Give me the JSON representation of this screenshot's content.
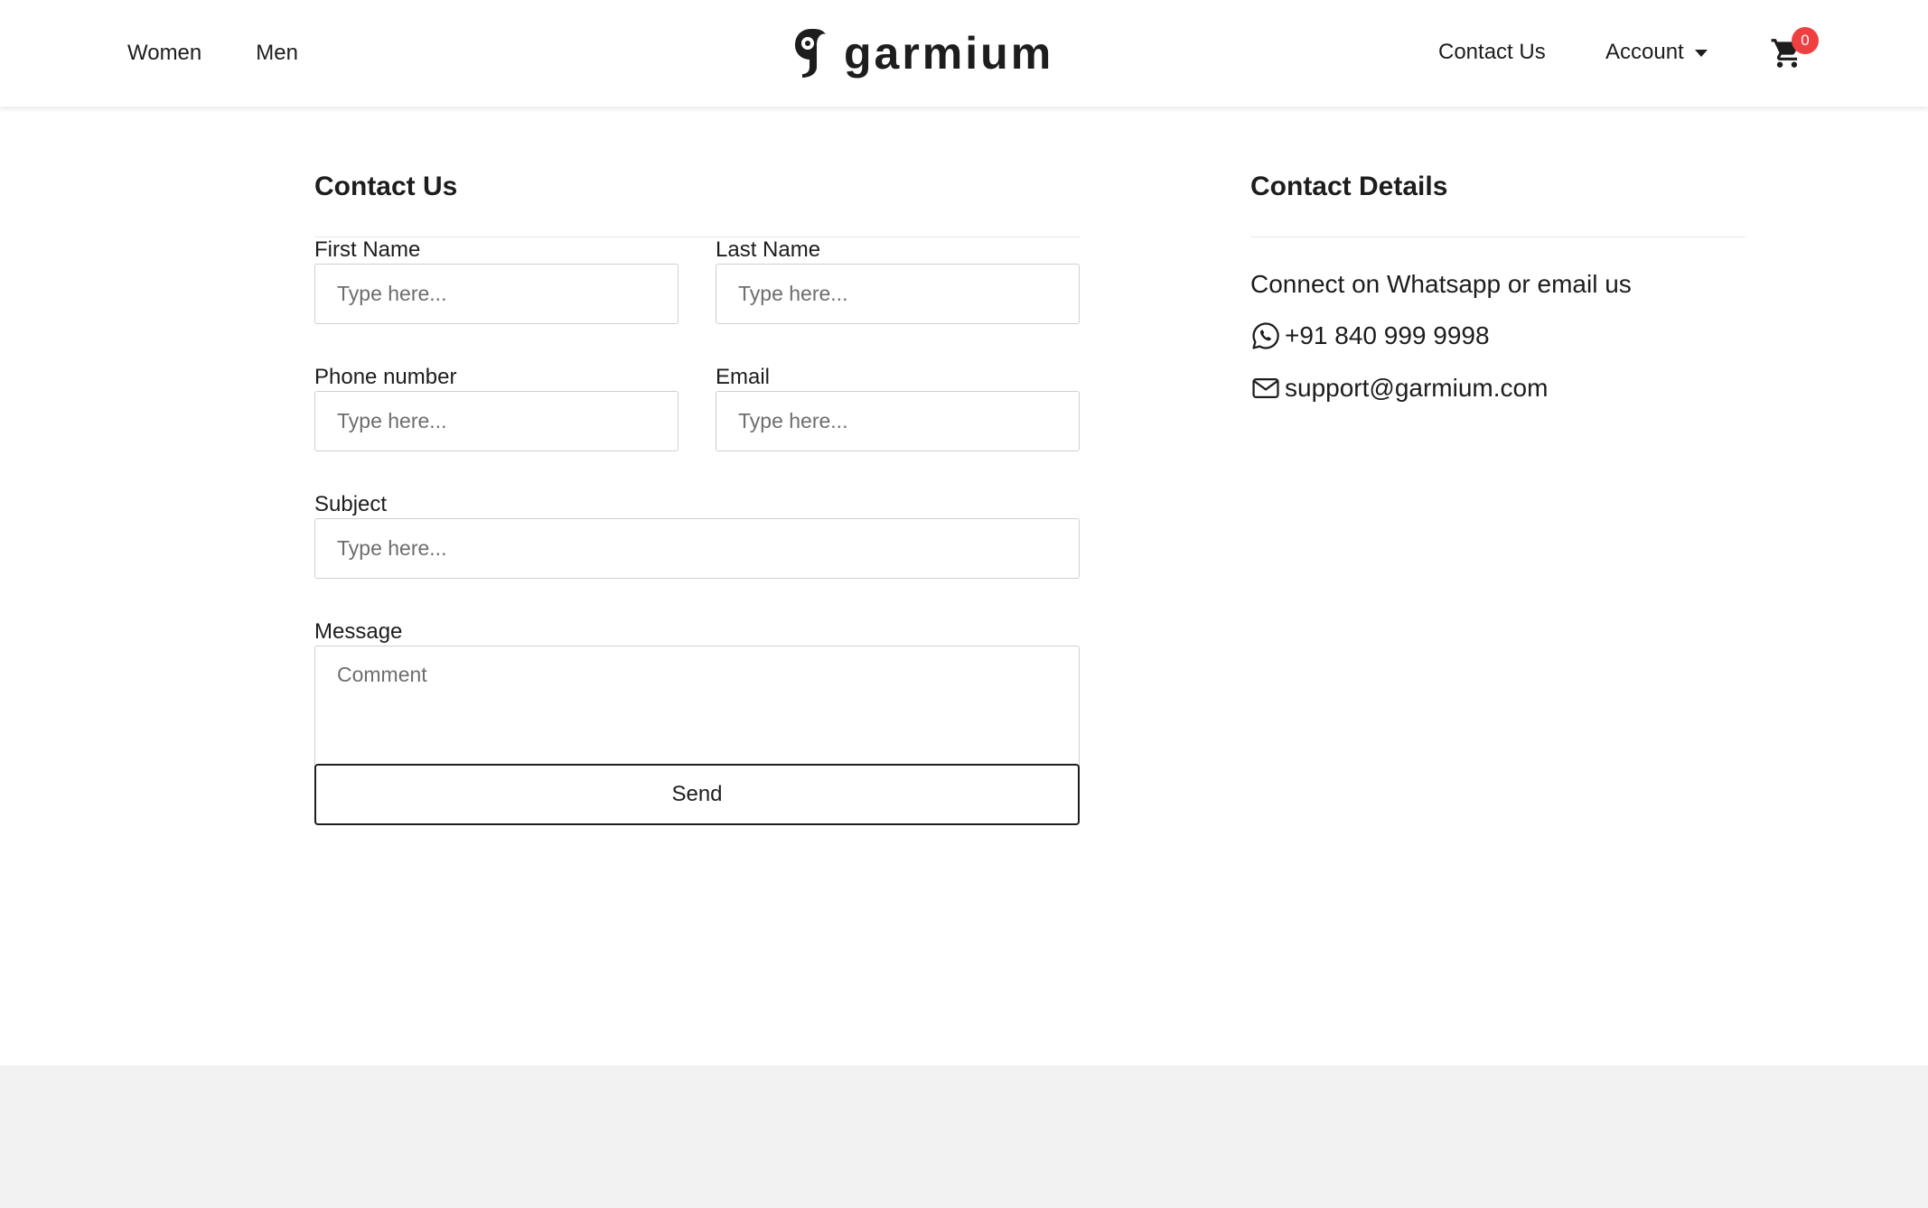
{
  "header": {
    "nav_left": [
      {
        "label": "Women"
      },
      {
        "label": "Men"
      }
    ],
    "logo_text": "garmium",
    "nav_right": {
      "contact_label": "Contact Us",
      "account_label": "Account",
      "cart_count": "0"
    }
  },
  "form": {
    "title": "Contact Us",
    "first_name": {
      "label": "First Name",
      "placeholder": "Type here..."
    },
    "last_name": {
      "label": "Last Name",
      "placeholder": "Type here..."
    },
    "phone": {
      "label": "Phone number",
      "placeholder": "Type here..."
    },
    "email": {
      "label": "Email",
      "placeholder": "Type here..."
    },
    "subject": {
      "label": "Subject",
      "placeholder": "Type here..."
    },
    "message": {
      "label": "Message",
      "placeholder": "Comment"
    },
    "send_label": "Send"
  },
  "details": {
    "title": "Contact Details",
    "intro": "Connect on Whatsapp or email us",
    "phone": "+91 840 999 9998",
    "email": "support@garmium.com"
  },
  "colors": {
    "badge": "#ee4040",
    "footer_bg": "#f2f2f2",
    "text": "#1d1d1d"
  },
  "icons": [
    "logo-mark-icon",
    "caret-down-icon",
    "cart-icon",
    "whatsapp-icon",
    "mail-icon"
  ]
}
